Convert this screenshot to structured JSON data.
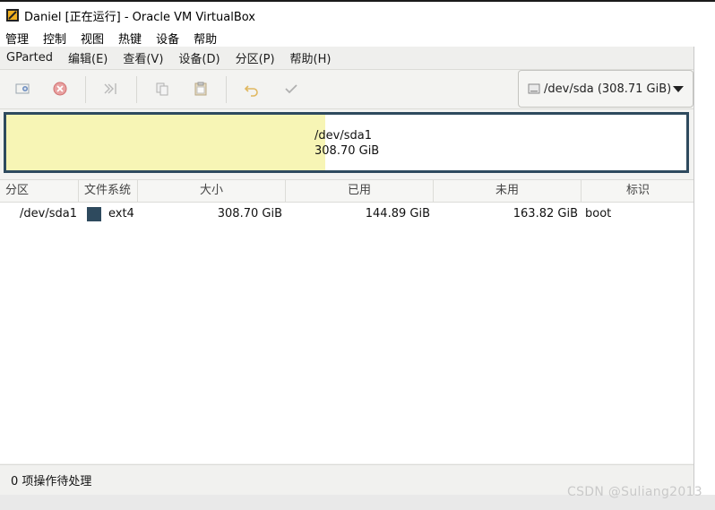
{
  "vbox": {
    "title": "Daniel [正在运行] - Oracle VM VirtualBox",
    "menu": [
      "管理",
      "控制",
      "视图",
      "热键",
      "设备",
      "帮助"
    ]
  },
  "gparted": {
    "menu": [
      "GParted",
      "编辑(E)",
      "查看(V)",
      "设备(D)",
      "分区(P)",
      "帮助(H)"
    ],
    "toolbar_icons": [
      "new-partition-icon",
      "delete-partition-icon",
      "resize-move-icon",
      "copy-icon",
      "paste-icon",
      "undo-icon",
      "apply-icon"
    ],
    "device_selector": "/dev/sda (308.71 GiB)",
    "disk_map": {
      "partition": "/dev/sda1",
      "size": "308.70 GiB",
      "used_fraction": 0.469,
      "used_color": "#f7f5b5",
      "border_color": "#2e4a5e"
    },
    "table": {
      "columns": [
        "分区",
        "文件系统",
        "大小",
        "已用",
        "未用",
        "标识"
      ],
      "rows": [
        {
          "partition": "/dev/sda1",
          "filesystem": "ext4",
          "size": "308.70 GiB",
          "used": "144.89 GiB",
          "unused": "163.82 GiB",
          "flags": "boot",
          "fs_color": "#2e4a5e"
        }
      ]
    },
    "status": "0 项操作待处理"
  },
  "watermark": "CSDN @Suliang2013",
  "colors": {
    "annotation": "#e0148c"
  }
}
